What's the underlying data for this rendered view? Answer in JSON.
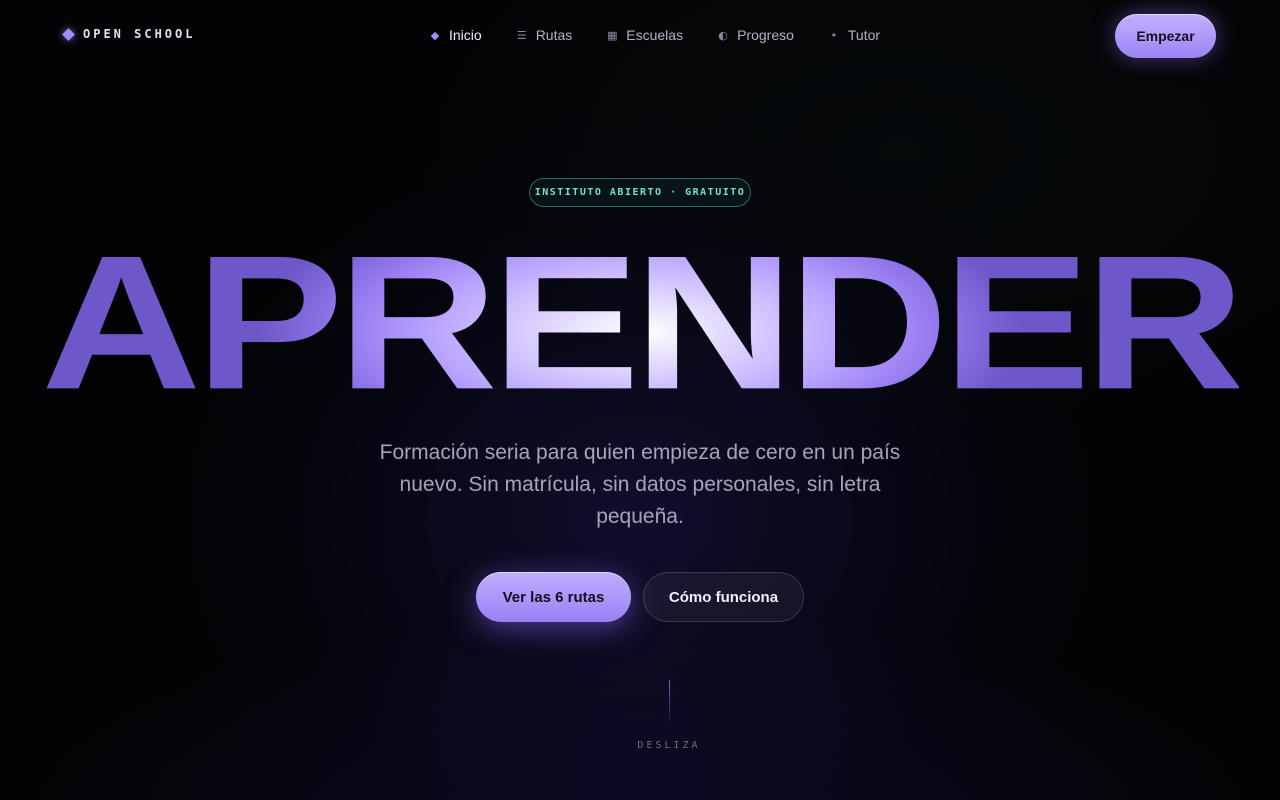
{
  "brand": {
    "name": "OPEN SCHOOL",
    "icon": "diamond-icon"
  },
  "nav": {
    "items": [
      {
        "label": "Inicio",
        "icon": "diamond-icon",
        "glyph": "◆",
        "active": true
      },
      {
        "label": "Rutas",
        "icon": "list-icon",
        "glyph": "☰",
        "active": false
      },
      {
        "label": "Escuelas",
        "icon": "grid-icon",
        "glyph": "▦",
        "active": false
      },
      {
        "label": "Progreso",
        "icon": "half-circle-icon",
        "glyph": "◐",
        "active": false
      },
      {
        "label": "Tutor",
        "icon": "dot-icon",
        "glyph": "•",
        "active": false
      }
    ],
    "cta_label": "Empezar"
  },
  "hero": {
    "badge": "INSTITUTO ABIERTO · GRATUITO",
    "headline": "APRENDER",
    "subtitle": "Formación seria para quien empieza de cero en un país nuevo. Sin matrícula, sin datos personales, sin letra pequeña.",
    "primary_button": "Ver las 6 rutas",
    "secondary_button": "Cómo funciona",
    "scroll_hint": "DESLIZA"
  },
  "colors": {
    "accent": "#a58bff",
    "badge_teal": "#6fe0cf",
    "background": "#030305"
  }
}
